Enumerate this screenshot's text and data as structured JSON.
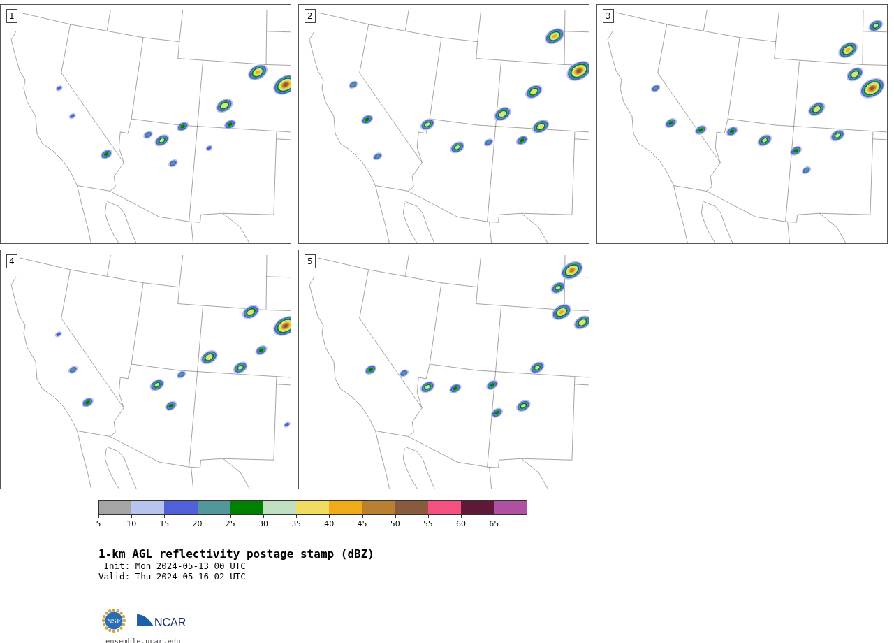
{
  "panels": [
    {
      "label": "1"
    },
    {
      "label": "2"
    },
    {
      "label": "3"
    },
    {
      "label": "4"
    },
    {
      "label": "5"
    }
  ],
  "colorbar": {
    "bins": [
      {
        "color": "#a5a5a5",
        "tick": "5"
      },
      {
        "color": "#b8c3ee",
        "tick": "10"
      },
      {
        "color": "#5060d8",
        "tick": "15"
      },
      {
        "color": "#50969a",
        "tick": "20"
      },
      {
        "color": "#008000",
        "tick": "25"
      },
      {
        "color": "#c0dfc0",
        "tick": "30"
      },
      {
        "color": "#f0dc60",
        "tick": "35"
      },
      {
        "color": "#f0ac18",
        "tick": "40"
      },
      {
        "color": "#b88030",
        "tick": "45"
      },
      {
        "color": "#8a5a3e",
        "tick": "50"
      },
      {
        "color": "#f45080",
        "tick": "55"
      },
      {
        "color": "#601838",
        "tick": "60"
      },
      {
        "color": "#b050a0",
        "tick": "65"
      }
    ]
  },
  "title": "1-km AGL reflectivity postage stamp (dBZ)",
  "init": " Init: Mon 2024-05-13 00 UTC",
  "valid": "Valid: Thu 2024-05-16 02 UTC",
  "logos": {
    "nsf": "NSF",
    "ncar": "NCAR"
  },
  "url": "ensemble.ucar.edu"
}
